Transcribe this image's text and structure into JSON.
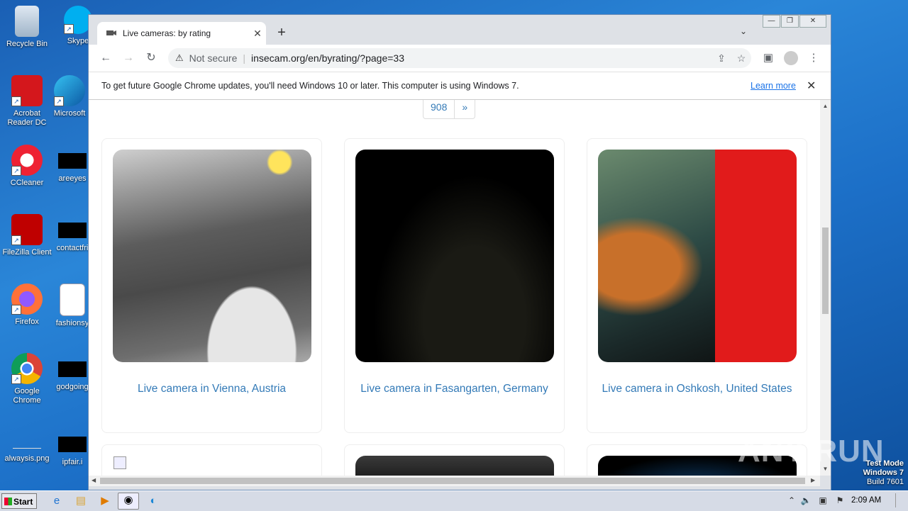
{
  "desktop": {
    "icons": [
      {
        "label": "Recycle Bin"
      },
      {
        "label": "Skype"
      },
      {
        "label": "Acrobat Reader DC"
      },
      {
        "label": "Microsoft"
      },
      {
        "label": "CCleaner"
      },
      {
        "label": "areeyes"
      },
      {
        "label": "FileZilla Client"
      },
      {
        "label": "contactfri"
      },
      {
        "label": "Firefox"
      },
      {
        "label": "fashionsy"
      },
      {
        "label": "Google Chrome"
      },
      {
        "label": "godgoing"
      },
      {
        "label": "alwaysis.png"
      },
      {
        "label": "ipfair.i"
      }
    ]
  },
  "browser": {
    "tab_title": "Live cameras: by rating",
    "new_tab_symbol": "+",
    "security_label": "Not secure",
    "url": "insecam.org/en/byrating/?page=33",
    "infobar": {
      "message": "To get future Google Chrome updates, you'll need Windows 10 or later. This computer is using Windows 7.",
      "link": "Learn more"
    }
  },
  "page": {
    "pager": {
      "last_page": "908",
      "next": "»"
    },
    "cameras": [
      {
        "caption": "Live camera in Vienna, Austria"
      },
      {
        "caption": "Live camera in Fasangarten, Germany"
      },
      {
        "caption": "Live camera in Oshkosh, United States"
      }
    ]
  },
  "taskbar": {
    "start_label": "Start",
    "clock": "2:09 AM"
  },
  "watermark": "ANY RUN",
  "os_info": {
    "line1": "Test Mode",
    "line2": "Windows 7",
    "line3": "Build 7601"
  }
}
